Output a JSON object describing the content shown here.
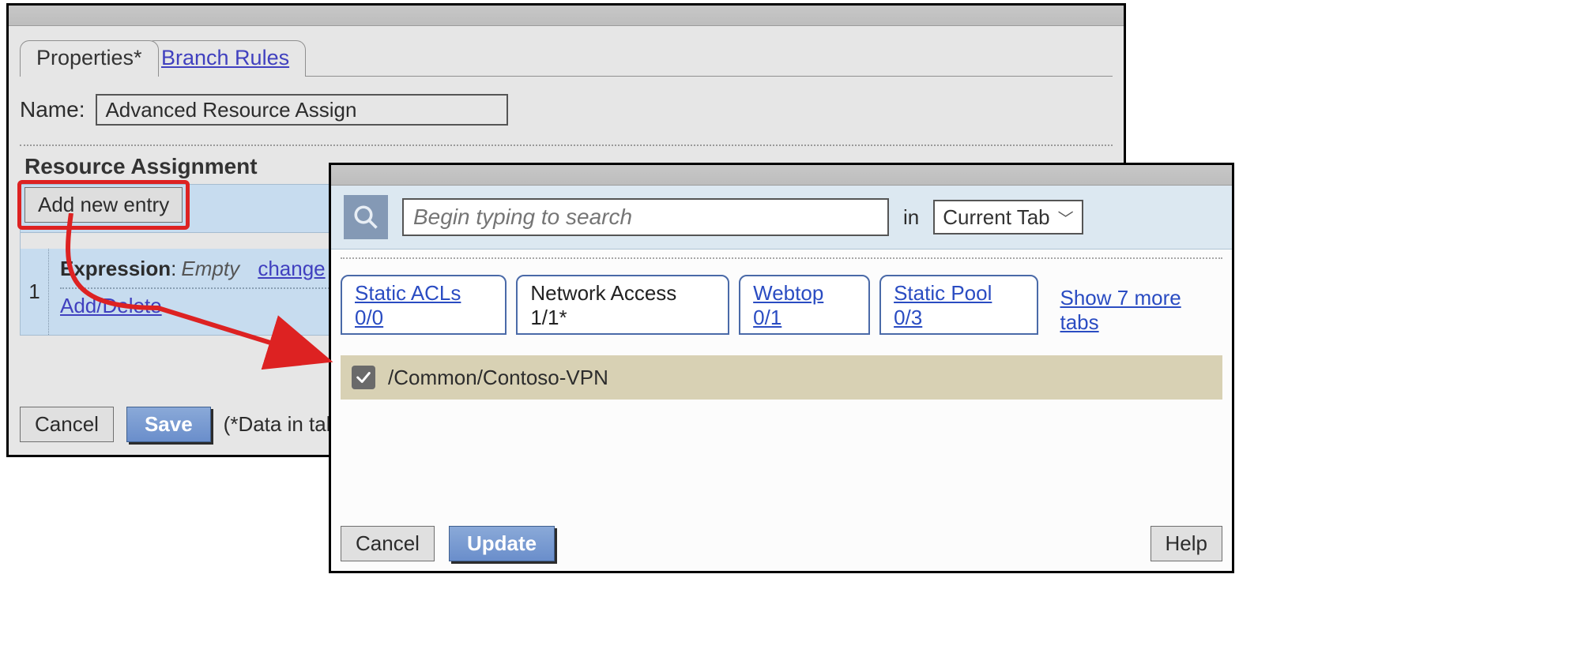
{
  "left": {
    "tabs": {
      "properties": "Properties*",
      "branch_rules": "Branch Rules"
    },
    "name_label": "Name:",
    "name_value": "Advanced Resource Assign",
    "section_title": "Resource Assignment",
    "add_entry": "Add new entry",
    "row_number": "1",
    "expression_label": "Expression",
    "expression_value": "Empty",
    "change": "change",
    "add_delete": "Add/Delete",
    "footer": {
      "cancel": "Cancel",
      "save": "Save",
      "hint": "(*Data in tab has"
    }
  },
  "right": {
    "search_placeholder": "Begin typing to search",
    "in": "in",
    "scope": "Current Tab",
    "tabs": {
      "static_acls": "Static ACLs 0/0",
      "network_access": "Network Access 1/1*",
      "webtop": "Webtop 0/1",
      "static_pool": "Static Pool 0/3"
    },
    "show_more": "Show 7 more tabs",
    "item": "/Common/Contoso-VPN",
    "item_checked": true,
    "footer": {
      "cancel": "Cancel",
      "update": "Update",
      "help": "Help"
    }
  }
}
